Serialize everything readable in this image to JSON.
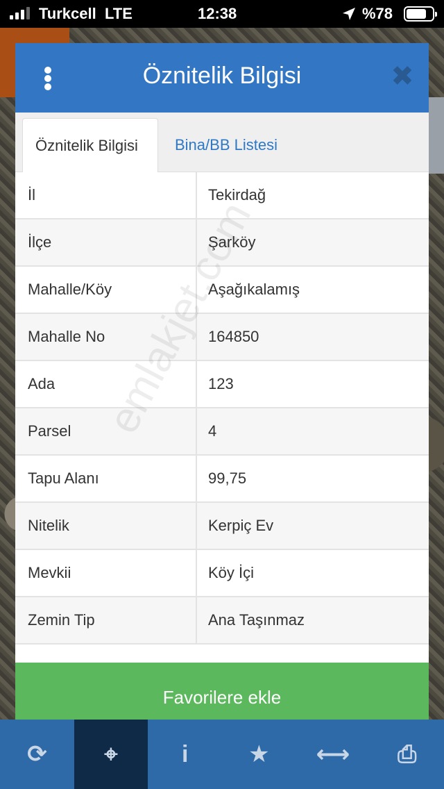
{
  "status_bar": {
    "carrier": "Turkcell",
    "network": "LTE",
    "time": "12:38",
    "battery": "%78",
    "battery_level": 0.78
  },
  "modal": {
    "title": "Öznitelik Bilgisi",
    "tabs": [
      {
        "label": "Öznitelik Bilgisi",
        "active": true
      },
      {
        "label": "Bina/BB Listesi",
        "active": false
      }
    ],
    "rows": [
      {
        "label": "İl",
        "value": "Tekirdağ"
      },
      {
        "label": "İlçe",
        "value": "Şarköy"
      },
      {
        "label": "Mahalle/Köy",
        "value": "Aşağıkalamış"
      },
      {
        "label": "Mahalle No",
        "value": "164850"
      },
      {
        "label": "Ada",
        "value": "123"
      },
      {
        "label": "Parsel",
        "value": "4"
      },
      {
        "label": "Tapu Alanı",
        "value": "99,75"
      },
      {
        "label": "Nitelik",
        "value": "Kerpiç Ev"
      },
      {
        "label": "Mevkii",
        "value": "Köy İçi"
      },
      {
        "label": "Zemin Tip",
        "value": "Ana Taşınmaz"
      }
    ],
    "favorite_button": "Favorilere ekle"
  },
  "watermark": "emlakjet.com",
  "toolbar": {
    "items": [
      {
        "icon": "refresh-icon",
        "glyph": "⟳",
        "active": false
      },
      {
        "icon": "crosshair-icon",
        "glyph": "⌖",
        "active": true
      },
      {
        "icon": "info-icon",
        "glyph": "i",
        "active": true
      },
      {
        "icon": "star-icon",
        "glyph": "★",
        "active": false
      },
      {
        "icon": "measure-icon",
        "glyph": "⟷",
        "active": false
      },
      {
        "icon": "print-icon",
        "glyph": "⎙",
        "active": false
      }
    ]
  },
  "colors": {
    "header": "#3377c4",
    "tab_link": "#2f78c4",
    "favorite": "#5cb85c",
    "toolbar": "#2e6aa8"
  }
}
